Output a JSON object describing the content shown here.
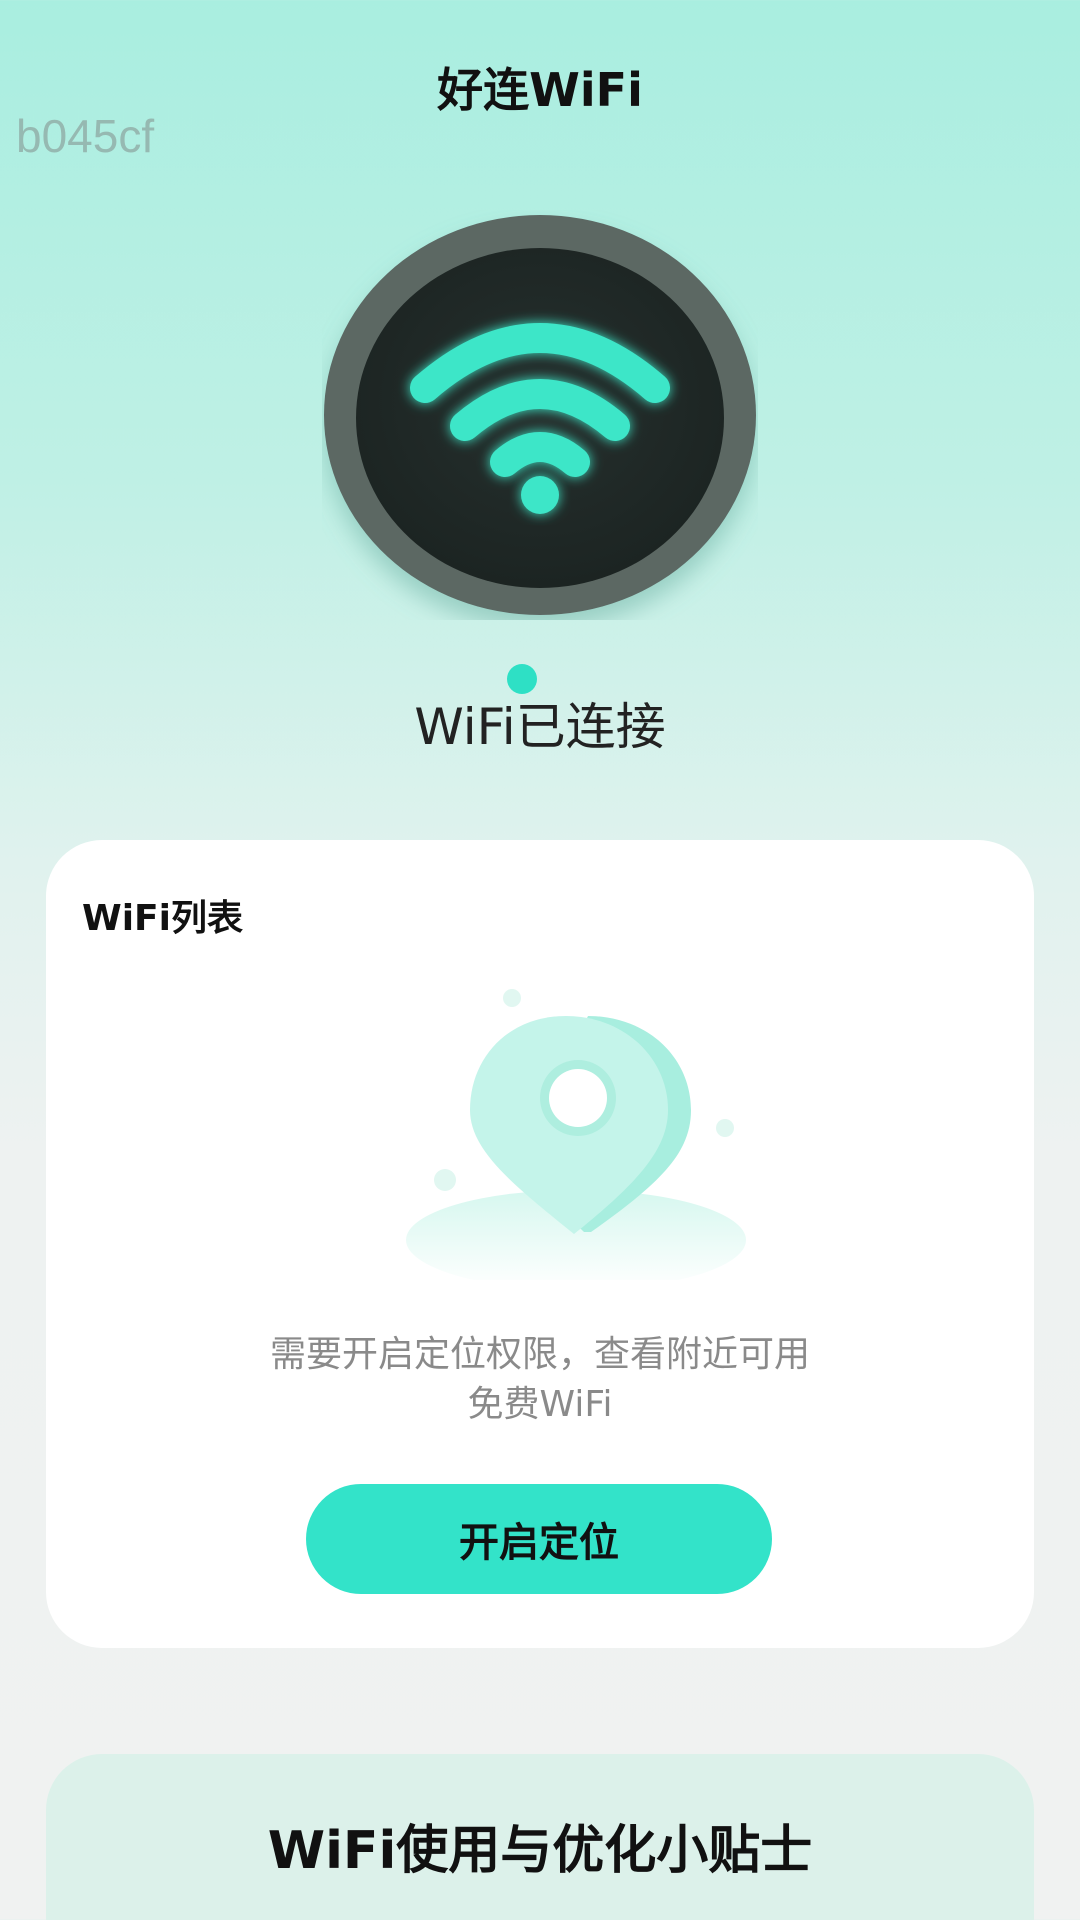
{
  "header": {
    "title": "好连WiFi",
    "watermark": "b045cf"
  },
  "status": {
    "icon": "wifi-icon",
    "text": "WiFi已连接",
    "dot_color": "#2ee0c5"
  },
  "wifi_list": {
    "title": "WiFi列表",
    "illustration": "location-pin-icon",
    "hint_line1": "需要开启定位权限，查看附近可用",
    "hint_line2": "免费WiFi",
    "button_label": "开启定位"
  },
  "tips": {
    "title": "WiFi使用与优化小贴士"
  },
  "colors": {
    "accent": "#33e3c9",
    "wifi_glow": "#3ee6c8",
    "badge_dark": "#1f2a28"
  }
}
